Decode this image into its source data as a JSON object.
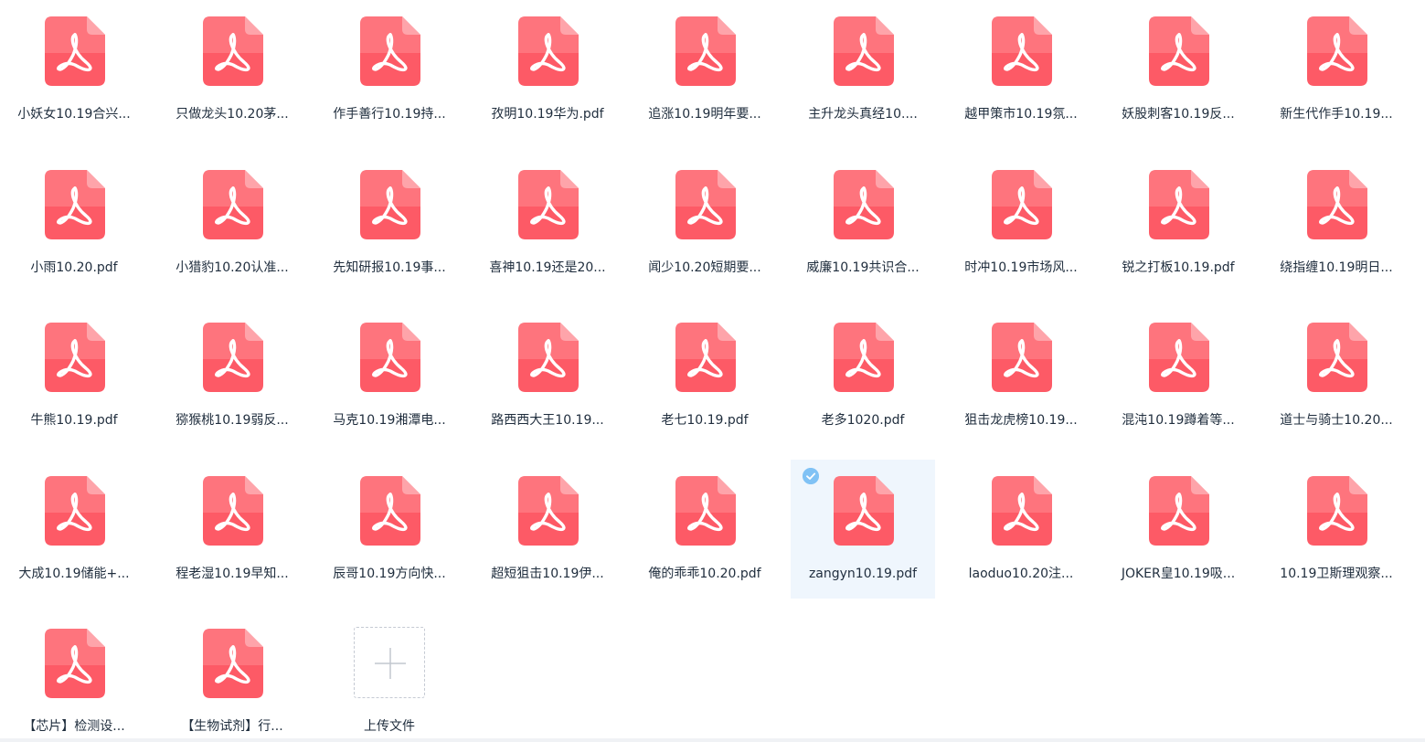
{
  "files": [
    {
      "name": "小妖女10.19合兴..."
    },
    {
      "name": "只做龙头10.20茅..."
    },
    {
      "name": "作手善行10.19持..."
    },
    {
      "name": "孜明10.19华为.pdf"
    },
    {
      "name": "追涨10.19明年要..."
    },
    {
      "name": "主升龙头真经10...."
    },
    {
      "name": "越甲策市10.19氛..."
    },
    {
      "name": "妖股刺客10.19反..."
    },
    {
      "name": "新生代作手10.19..."
    },
    {
      "name": "小雨10.20.pdf"
    },
    {
      "name": "小猎豹10.20认准..."
    },
    {
      "name": "先知研报10.19事..."
    },
    {
      "name": "喜神10.19还是20..."
    },
    {
      "name": "闻少10.20短期要..."
    },
    {
      "name": "威廉10.19共识合..."
    },
    {
      "name": "时冲10.19市场风..."
    },
    {
      "name": "锐之打板10.19.pdf"
    },
    {
      "name": "绕指缠10.19明日..."
    },
    {
      "name": "牛熊10.19.pdf"
    },
    {
      "name": "猕猴桃10.19弱反..."
    },
    {
      "name": "马克10.19湘潭电..."
    },
    {
      "name": "路西西大王10.19..."
    },
    {
      "name": "老七10.19.pdf"
    },
    {
      "name": "老多1020.pdf"
    },
    {
      "name": "狙击龙虎榜10.19..."
    },
    {
      "name": "混沌10.19蹲着等..."
    },
    {
      "name": "道士与骑士10.20..."
    },
    {
      "name": "大成10.19储能+..."
    },
    {
      "name": "程老湿10.19早知..."
    },
    {
      "name": "辰哥10.19方向快..."
    },
    {
      "name": "超短狙击10.19伊..."
    },
    {
      "name": "俺的乖乖10.20.pdf"
    },
    {
      "name": "zangyn10.19.pdf",
      "selected": true
    },
    {
      "name": "laoduo10.20注..."
    },
    {
      "name": "JOKER皇10.19吸..."
    },
    {
      "name": "10.19卫斯理观察..."
    },
    {
      "name": "【芯片】检测设..."
    },
    {
      "name": "【生物试剂】行..."
    }
  ],
  "upload": {
    "label": "上传文件"
  },
  "icon": {
    "name": "pdf-icon",
    "color_top": "#ff8a8f",
    "color_bottom": "#fd5a66"
  },
  "selection": {
    "color": "#eff6fd",
    "check_color": "#80c2f5"
  }
}
